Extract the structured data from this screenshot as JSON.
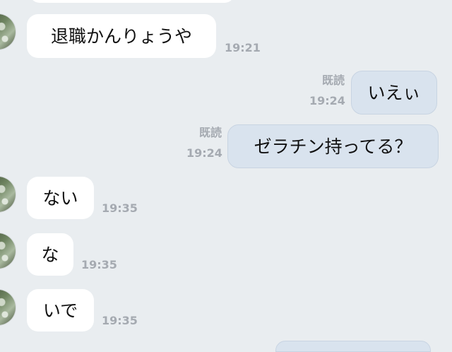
{
  "messages": [
    {
      "id": "m1",
      "text": "退職かんりょうや",
      "time": "19:21"
    },
    {
      "id": "m2",
      "text": "いえぃ",
      "status": "既読",
      "time": "19:24"
    },
    {
      "id": "m3",
      "text": "ゼラチン持ってる？",
      "status": "既読",
      "time": "19:24"
    },
    {
      "id": "m4",
      "text": "ない",
      "time": "19:35"
    },
    {
      "id": "m5",
      "text": "な",
      "time": "19:35"
    },
    {
      "id": "m6",
      "text": "いで",
      "time": "19:35"
    }
  ]
}
